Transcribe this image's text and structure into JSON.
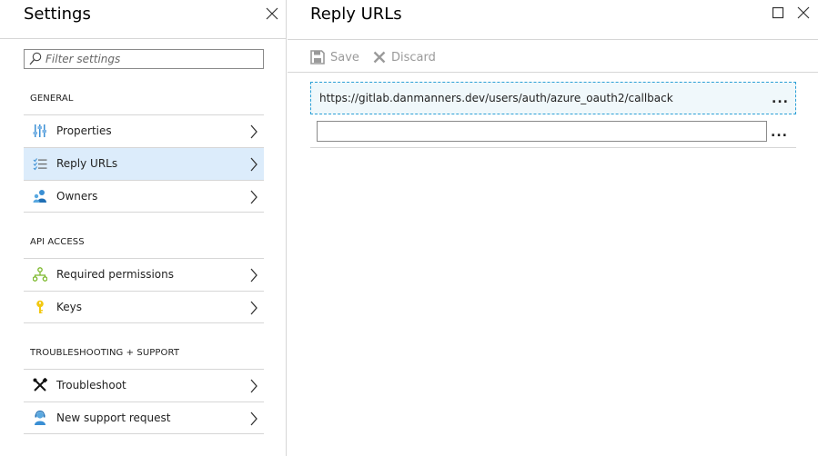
{
  "settings": {
    "title": "Settings",
    "filter_placeholder": "Filter settings",
    "sections": [
      {
        "label": "GENERAL",
        "items": [
          {
            "label": "Properties",
            "icon": "properties-icon"
          },
          {
            "label": "Reply URLs",
            "icon": "reply-urls-icon",
            "active": true
          },
          {
            "label": "Owners",
            "icon": "owners-icon"
          }
        ]
      },
      {
        "label": "API ACCESS",
        "items": [
          {
            "label": "Required permissions",
            "icon": "permissions-icon"
          },
          {
            "label": "Keys",
            "icon": "key-icon"
          }
        ]
      },
      {
        "label": "TROUBLESHOOTING + SUPPORT",
        "items": [
          {
            "label": "Troubleshoot",
            "icon": "troubleshoot-icon"
          },
          {
            "label": "New support request",
            "icon": "support-request-icon"
          }
        ]
      }
    ]
  },
  "reply_urls": {
    "title": "Reply URLs",
    "toolbar": {
      "save_label": "Save",
      "discard_label": "Discard"
    },
    "urls": [
      "https://gitlab.danmanners.dev/users/auth/azure_oauth2/callback"
    ],
    "new_url_value": "",
    "more_label": "..."
  },
  "colors": {
    "accent": "#2a9fd6",
    "active_item_bg": "#dcecfb",
    "disabled_text": "#9a9a9a"
  }
}
